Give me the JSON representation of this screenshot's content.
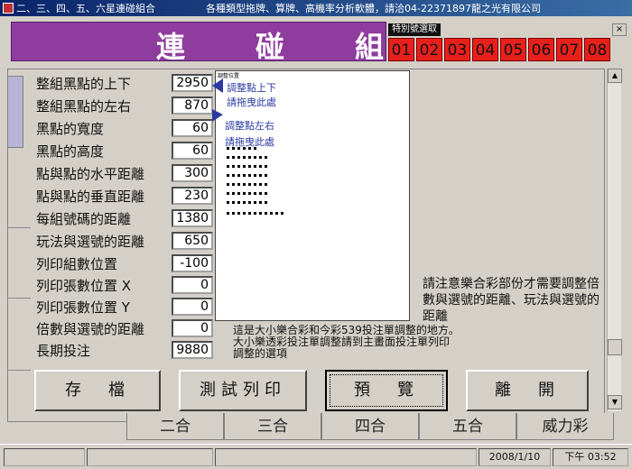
{
  "window": {
    "title": "二、三、四、五、六星連碰組合",
    "subtitle": "各種類型拖牌、算牌、高機率分析軟體，請洽04-22371897龍之光有限公司"
  },
  "banner": {
    "chars": [
      "連",
      "碰",
      "組"
    ]
  },
  "special": {
    "label": "特別號選取",
    "close": "×",
    "numbers": [
      "01",
      "02",
      "03",
      "04",
      "05",
      "06",
      "07",
      "08"
    ]
  },
  "fields": [
    {
      "label": "整組黑點的上下",
      "value": "2950"
    },
    {
      "label": "整組黑點的左右",
      "value": "870"
    },
    {
      "label": "黑點的寬度",
      "value": "60"
    },
    {
      "label": "黑點的高度",
      "value": "60"
    },
    {
      "label": "點與點的水平距離",
      "value": "300"
    },
    {
      "label": "點與點的垂直距離",
      "value": "230"
    },
    {
      "label": "每組號碼的距離",
      "value": "1380"
    },
    {
      "label": "玩法與選號的距離",
      "value": "650"
    },
    {
      "label": "列印組數位置",
      "value": "-100"
    },
    {
      "label": "列印張數位置 X",
      "value": "0"
    },
    {
      "label": "列印張數位置 Y",
      "value": "0"
    },
    {
      "label": "倍數與選號的距離",
      "value": "0"
    },
    {
      "label": "長期投注",
      "value": "9880"
    }
  ],
  "preview": {
    "tiny_label": "調整位置",
    "hint1_a": "調整點上下",
    "hint1_b": "請拖曳此處",
    "hint2_a": "調整點左右",
    "hint2_b": "請拖曳此處"
  },
  "notes": {
    "right": "請注意樂合彩部份才需要調整倍數與選號的距離、玩法與選號的距離",
    "bottom_1": "這是大小樂合彩和今彩539投注單調整的地方。",
    "bottom_2": "大小樂透彩投注單調整請到主畫面投注單列印",
    "bottom_3": "調整的選項"
  },
  "buttons": {
    "save": "存　檔",
    "test_print": "測試列印",
    "preview": "預　覽",
    "exit": "離　開"
  },
  "tabs": [
    "二合",
    "三合",
    "四合",
    "五合",
    "威力彩"
  ],
  "status": {
    "date": "2008/1/10",
    "time": "下午 03:52"
  },
  "colors": {
    "banner": "#8e3c9e",
    "number_button": "#e8201c",
    "titlebar": "#0a246a"
  }
}
